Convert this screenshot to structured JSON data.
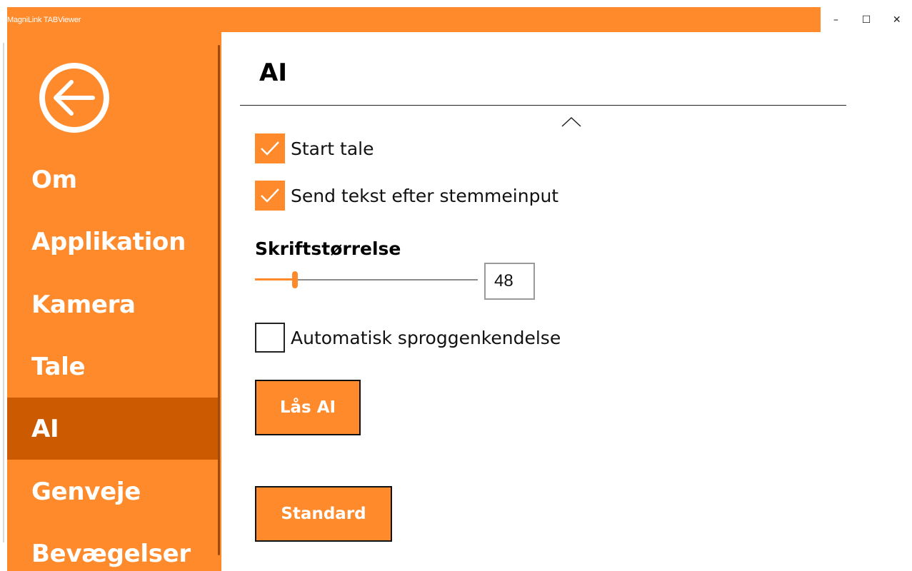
{
  "window": {
    "title": "MagniLink TABViewer",
    "controls": {
      "minimize": "–",
      "maximize": "☐",
      "close": "✕"
    }
  },
  "colors": {
    "accent": "#ff8a2b",
    "active": "#cc5a00"
  },
  "sidebar": {
    "back_icon": "back-arrow-circle-icon",
    "items": [
      {
        "label": "Om",
        "active": false
      },
      {
        "label": "Applikation",
        "active": false
      },
      {
        "label": "Kamera",
        "active": false
      },
      {
        "label": "Tale",
        "active": false
      },
      {
        "label": "AI",
        "active": true
      },
      {
        "label": "Genveje",
        "active": false
      },
      {
        "label": "Bevægelser",
        "active": false
      }
    ]
  },
  "main": {
    "heading": "AI",
    "options": [
      {
        "label": "Start tale",
        "checked": true
      },
      {
        "label": "Send tekst efter stemmeinput",
        "checked": true
      }
    ],
    "font_size": {
      "label": "Skriftstørrelse",
      "value": "48",
      "slider_fraction": 0.18
    },
    "auto_language": {
      "label": "Automatisk sproggenkendelse",
      "checked": false
    },
    "lock_button": "Lås AI",
    "default_button": "Standard"
  }
}
